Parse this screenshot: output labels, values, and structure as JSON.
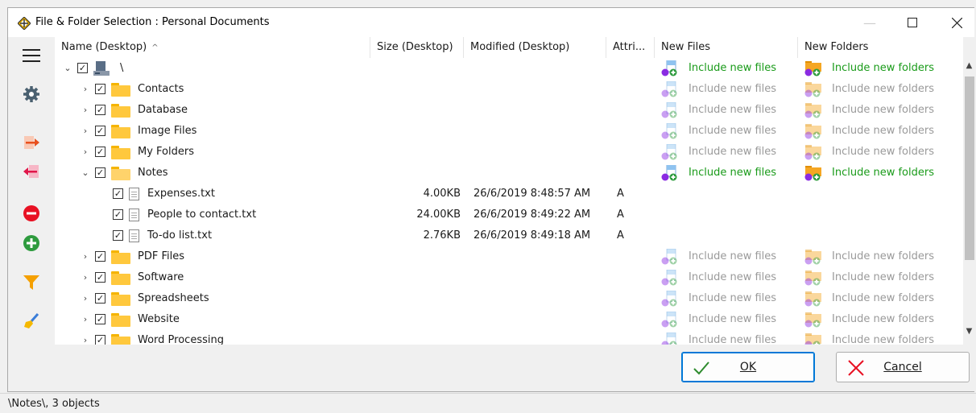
{
  "window": {
    "title": "File & Folder Selection : Personal Documents"
  },
  "columns": {
    "name": "Name (Desktop)",
    "size": "Size (Desktop)",
    "modified": "Modified (Desktop)",
    "attributes": "Attri...",
    "new_files": "New Files",
    "new_folders": "New Folders"
  },
  "toolbar_icons": [
    "menu-icon",
    "gear-icon",
    "arrow-right-icon",
    "arrow-left-icon",
    "remove-icon",
    "add-icon",
    "filter-icon",
    "brush-icon"
  ],
  "rows": [
    {
      "kind": "root",
      "name": "\\",
      "expanded": true,
      "new_files": "Include new files",
      "new_folders": "Include new folders",
      "rule_active": true
    },
    {
      "kind": "folder",
      "name": "Contacts",
      "expanded": false,
      "new_files": "Include new files",
      "new_folders": "Include new folders",
      "rule_active": false
    },
    {
      "kind": "folder",
      "name": "Database",
      "expanded": false,
      "new_files": "Include new files",
      "new_folders": "Include new folders",
      "rule_active": false
    },
    {
      "kind": "folder",
      "name": "Image Files",
      "expanded": false,
      "new_files": "Include new files",
      "new_folders": "Include new folders",
      "rule_active": false
    },
    {
      "kind": "folder",
      "name": "My Folders",
      "expanded": false,
      "new_files": "Include new files",
      "new_folders": "Include new folders",
      "rule_active": false
    },
    {
      "kind": "folder",
      "name": "Notes",
      "expanded": true,
      "new_files": "Include new files",
      "new_folders": "Include new folders",
      "rule_active": true
    },
    {
      "kind": "file",
      "name": "Expenses.txt",
      "size": "4.00KB",
      "modified": "26/6/2019 8:48:57 AM",
      "attr": "A"
    },
    {
      "kind": "file",
      "name": "People to contact.txt",
      "size": "24.00KB",
      "modified": "26/6/2019 8:49:22 AM",
      "attr": "A"
    },
    {
      "kind": "file",
      "name": "To-do list.txt",
      "size": "2.76KB",
      "modified": "26/6/2019 8:49:18 AM",
      "attr": "A"
    },
    {
      "kind": "folder",
      "name": "PDF Files",
      "expanded": false,
      "new_files": "Include new files",
      "new_folders": "Include new folders",
      "rule_active": false
    },
    {
      "kind": "folder",
      "name": "Software",
      "expanded": false,
      "new_files": "Include new files",
      "new_folders": "Include new folders",
      "rule_active": false
    },
    {
      "kind": "folder",
      "name": "Spreadsheets",
      "expanded": false,
      "new_files": "Include new files",
      "new_folders": "Include new folders",
      "rule_active": false
    },
    {
      "kind": "folder",
      "name": "Website",
      "expanded": false,
      "new_files": "Include new files",
      "new_folders": "Include new folders",
      "rule_active": false
    },
    {
      "kind": "folder",
      "name": "Word Processing",
      "expanded": false,
      "new_files": "Include new files",
      "new_folders": "Include new folders",
      "rule_active": false
    }
  ],
  "buttons": {
    "ok": "OK",
    "cancel": "Cancel"
  },
  "status": {
    "text": "\\Notes\\, 3 objects"
  },
  "colors": {
    "accent": "#0078d7",
    "rule_on": "#1a9b1a",
    "rule_off": "#9a9a9a",
    "folder": "#ffc83d",
    "ok_check": "#2e8b2e",
    "cancel_x": "#e81123"
  }
}
